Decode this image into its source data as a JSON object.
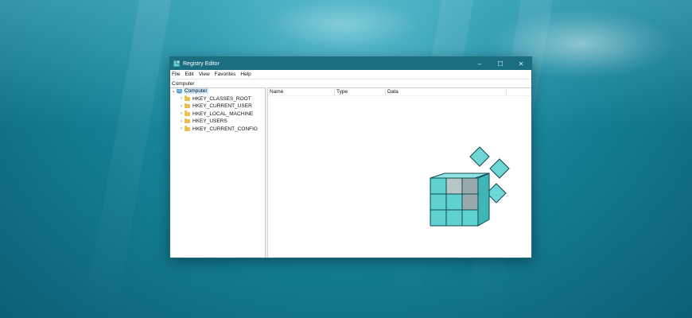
{
  "window": {
    "title": "Registry Editor",
    "controls": {
      "minimize": "–",
      "maximize": "☐",
      "close": "✕"
    }
  },
  "menubar": [
    "File",
    "Edit",
    "View",
    "Favorites",
    "Help"
  ],
  "address": "Computer",
  "tree": {
    "root": "Computer",
    "keys": [
      "HKEY_CLASSES_ROOT",
      "HKEY_CURRENT_USER",
      "HKEY_LOCAL_MACHINE",
      "HKEY_USERS",
      "HKEY_CURRENT_CONFIG"
    ]
  },
  "list": {
    "columns": [
      "Name",
      "Type",
      "Data"
    ]
  },
  "colors": {
    "accent": "#1b6e80",
    "selection": "#cce8ff",
    "folder": "#e9c04c",
    "logo": "#5fd1d1"
  }
}
